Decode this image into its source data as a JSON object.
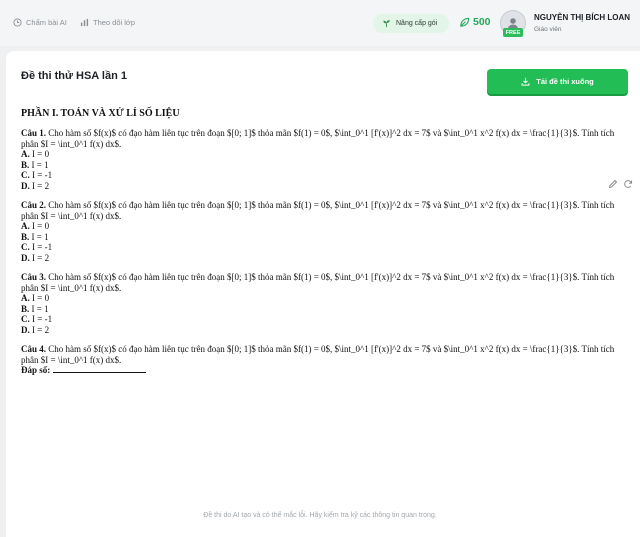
{
  "header": {
    "nav": [
      {
        "label": "Chấm bài AI",
        "icon": "clock-icon"
      },
      {
        "label": "Theo dõi lớp",
        "icon": "chart-bars-icon"
      }
    ],
    "upgrade_label": "Nâng cấp gói",
    "credits": "500",
    "user": {
      "name": "NGUYỄN THỊ BÍCH LOAN",
      "role": "Giáo viên",
      "badge": "FREE"
    }
  },
  "exam": {
    "title": "Đề thi thử HSA lần 1",
    "download_label": "Tải đề thi xuống",
    "section_title": "PHẦN I. TOÁN VÀ XỬ LÍ SỐ LIỆU",
    "questions": [
      {
        "label": "Câu 1.",
        "text": " Cho hàm số $f(x)$ có đạo hàm liên tục trên đoạn $[0; 1]$ thỏa mãn $f(1) = 0$, $\\int_0^1 [f'(x)]^2 dx = 7$ và $\\int_0^1 x^2 f(x) dx = \\frac{1}{3}$. Tính tích phân $I = \\int_0^1 f(x) dx$.",
        "options": [
          {
            "letter": "A.",
            "text": " I = 0"
          },
          {
            "letter": "B.",
            "text": " I = 1"
          },
          {
            "letter": "C.",
            "text": " I = -1"
          },
          {
            "letter": "D.",
            "text": " I = 2"
          }
        ]
      },
      {
        "label": "Câu 2.",
        "text": " Cho hàm số $f(x)$ có đạo hàm liên tục trên đoạn $[0; 1]$ thỏa mãn $f(1) = 0$, $\\int_0^1 [f'(x)]^2 dx = 7$ và $\\int_0^1 x^2 f(x) dx = \\frac{1}{3}$. Tính tích phân $I = \\int_0^1 f(x) dx$.",
        "options": [
          {
            "letter": "A.",
            "text": " I = 0"
          },
          {
            "letter": "B.",
            "text": " I = 1"
          },
          {
            "letter": "C.",
            "text": " I = -1"
          },
          {
            "letter": "D.",
            "text": " I = 2"
          }
        ]
      },
      {
        "label": "Câu 3.",
        "text": " Cho hàm số $f(x)$ có đạo hàm liên tục trên đoạn $[0; 1]$ thỏa mãn $f(1) = 0$, $\\int_0^1 [f'(x)]^2 dx = 7$ và $\\int_0^1 x^2 f(x) dx = \\frac{1}{3}$. Tính tích phân $I = \\int_0^1 f(x) dx$.",
        "options": [
          {
            "letter": "A.",
            "text": " I = 0"
          },
          {
            "letter": "B.",
            "text": " I = 1"
          },
          {
            "letter": "C.",
            "text": " I = -1"
          },
          {
            "letter": "D.",
            "text": " I = 2"
          }
        ]
      },
      {
        "label": "Câu 4.",
        "text": " Cho hàm số $f(x)$ có đạo hàm liên tục trên đoạn $[0; 1]$ thỏa mãn $f(1) = 0$, $\\int_0^1 [f'(x)]^2 dx = 7$ và $\\int_0^1 x^2 f(x) dx = \\frac{1}{3}$. Tính tích phân $I = \\int_0^1 f(x) dx$.",
        "answer_label": "Đáp số:"
      }
    ]
  },
  "footer_note": "Đề thi do AI tạo và có thể mắc lỗi. Hãy kiểm tra kỹ các thông tin quan trọng.",
  "colors": {
    "accent": "#23bd55",
    "credits": "#22a85a",
    "upgrade_bg": "#e3f5e6"
  }
}
